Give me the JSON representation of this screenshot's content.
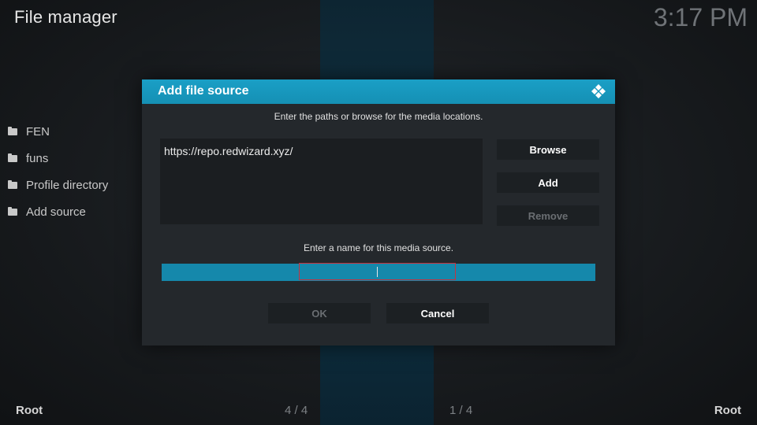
{
  "app": {
    "title": "File manager",
    "clock": "3:17 PM"
  },
  "sidebar": {
    "items": [
      {
        "label": "FEN",
        "icon": "folder-icon"
      },
      {
        "label": "funs",
        "icon": "folder-icon"
      },
      {
        "label": "Profile directory",
        "icon": "folder-icon"
      },
      {
        "label": "Add source",
        "icon": "folder-icon"
      }
    ]
  },
  "footer": {
    "left": "Root",
    "left_count": "4 / 4",
    "right_count": "1 / 4",
    "right": "Root"
  },
  "dialog": {
    "title": "Add file source",
    "logo_icon": "kodi-logo-icon",
    "paths_instruction": "Enter the paths or browse for the media locations.",
    "paths": [
      "https://repo.redwizard.xyz/"
    ],
    "browse_label": "Browse",
    "add_label": "Add",
    "remove_label": "Remove",
    "name_instruction": "Enter a name for this media source.",
    "name_value": "",
    "ok_label": "OK",
    "cancel_label": "Cancel"
  },
  "colors": {
    "accent": "#12a0c7",
    "focus_border": "#c9323d",
    "dialog_bg": "#24282c"
  }
}
